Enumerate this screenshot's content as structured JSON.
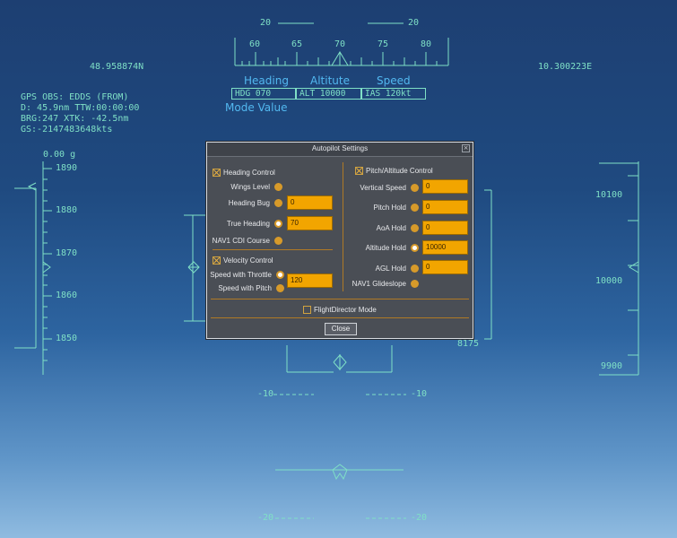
{
  "hud": {
    "top_scale_labels": [
      "20",
      "20"
    ],
    "heading_ticks": [
      "60",
      "65",
      "70",
      "75",
      "80"
    ],
    "lat": "48.958874N",
    "lon": "10.300223E",
    "mode_headers": [
      "Heading",
      "Altitute",
      "Speed"
    ],
    "mode_values": [
      "HDG 070",
      "ALT 10000",
      "IAS 120kt"
    ],
    "mode_value_label": "Mode Value",
    "gps": [
      "GPS OBS: EDDS (FROM)",
      "D: 45.9nm      TTW:00:00:00",
      "BRG:247      XTK: -42.5nm",
      "GS:-2147483648kts"
    ],
    "g_readout": "0.00 g",
    "speed_ticks": [
      "1890",
      "1880",
      "1870",
      "1860",
      "1850"
    ],
    "alt_ticks": [
      "10100",
      "10000",
      "9900"
    ],
    "vs_readout": "8175",
    "pitch_labels": [
      "-10",
      "-10",
      "-20",
      "-20"
    ],
    "colors": {
      "hud_line": "#7fe0c6",
      "hud_header": "#52b8f0",
      "field": "#f2a500",
      "accent": "#d79a2a"
    }
  },
  "dialog": {
    "title": "Autopilot Settings",
    "close_glyph": "×",
    "heading_control": {
      "label": "Heading Control",
      "checked": true,
      "wings_level": "Wings Level",
      "heading_bug": "Heading Bug",
      "heading_bug_value": "0",
      "true_heading": "True Heading",
      "true_heading_value": "70",
      "nav1_cdi": "NAV1 CDI Course",
      "selected": "true_heading"
    },
    "velocity_control": {
      "label": "Velocity Control",
      "checked": true,
      "throttle": "Speed with Throttle",
      "throttle_value": "120",
      "pitch": "Speed with Pitch",
      "selected": "throttle"
    },
    "pitch_control": {
      "label": "Pitch/Altitude Control",
      "checked": true,
      "vertical_speed": "Vertical Speed",
      "vertical_speed_value": "0",
      "pitch_hold": "Pitch Hold",
      "pitch_hold_value": "0",
      "aoa_hold": "AoA Hold",
      "aoa_hold_value": "0",
      "altitude_hold": "Altitude Hold",
      "altitude_hold_value": "10000",
      "agl_hold": "AGL Hold",
      "agl_hold_value": "0",
      "nav1_glideslope": "NAV1 Glideslope",
      "selected": "altitude_hold"
    },
    "flight_director": {
      "label": "FlightDirector Mode",
      "checked": false
    },
    "close_button": "Close"
  }
}
